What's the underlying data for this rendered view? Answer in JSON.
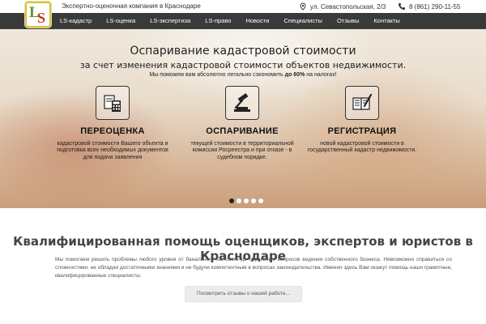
{
  "header": {
    "tagline": "Экспертно-оценочная компания в Краснодаре",
    "address": "ул. Севастопольская, 2/3",
    "phone": "8 (861) 290-11-55",
    "logo_text": "LS"
  },
  "nav": {
    "items": [
      "LS-кадастр",
      "LS-оценка",
      "LS-экспертиза",
      "LS-право",
      "Новости",
      "Специалисты",
      "Отзывы",
      "Контакты"
    ]
  },
  "hero": {
    "title": "Оспаривание кадастровой стоимости",
    "subtitle": "за счет изменения кадастровой стоимости объектов недвижимости.",
    "note_prefix": "Мы поможем вам абсолютно легально сэкономить ",
    "note_bold": "до 60%",
    "note_suffix": " на налогах!",
    "features": [
      {
        "title": "ПЕРЕОЦЕНКА",
        "text": "кадастровой стоимости Вашего объекта и подготовка всех необходимых документов для подачи заявления",
        "icon": "calculator-documents-icon"
      },
      {
        "title": "ОСПАРИВАНИЕ",
        "text": "текущей стоимости в территориальной комиссии Росреестра и при отказе - в судебном порядке.",
        "icon": "gavel-icon"
      },
      {
        "title": "РЕГИСТРАЦИЯ",
        "text": "новой кадастровой стоимости в государственный кадастр недвижимости.",
        "icon": "book-pen-icon"
      }
    ],
    "slides_total": 5,
    "active_slide": 1
  },
  "main": {
    "title": "Квалифицированная помощь оценщиков, экспертов и юристов в Краснодаре",
    "text": "Мы помогаем решить проблемы любого уровня от банального бытового до серьезных вопросов ведения собственного бизнеса. Невозможно справиться со сложностями, не обладая достаточными знаниями и не будучи компетентным в вопросах законодательства. Именно здесь Вам окажут помощь наши грамотные, квалифицированные специалисты.",
    "reviews_button": "Посмотреть отзывы о нашей работе..."
  },
  "colors": {
    "nav_bg": "#3a3a3a",
    "logo_border": "#d6c23a",
    "logo_l": "#6a8f2a",
    "logo_s": "#c0392b"
  }
}
